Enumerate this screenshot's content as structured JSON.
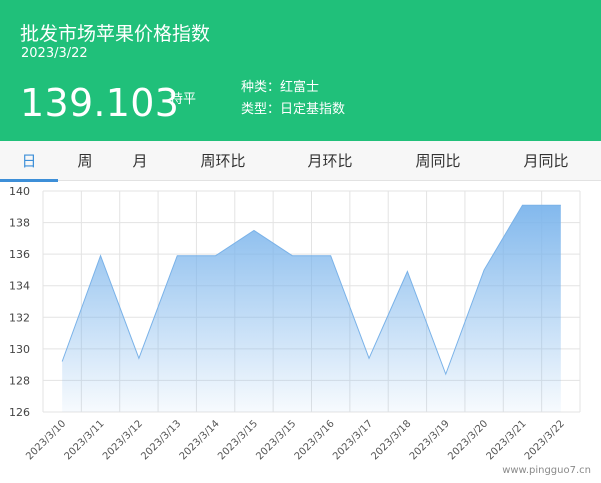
{
  "header": {
    "title": "批发市场苹果价格指数",
    "date": "2023/3/22",
    "price": "139.103",
    "trend": "持平",
    "variety": "种类：红富士",
    "index_type": "类型：日定基指数"
  },
  "tabs": [
    {
      "label": "日",
      "active": true
    },
    {
      "label": "周",
      "active": false
    },
    {
      "label": "月",
      "active": false
    },
    {
      "label": "周环比",
      "active": false
    },
    {
      "label": "月环比",
      "active": false
    },
    {
      "label": "周同比",
      "active": false
    },
    {
      "label": "月同比",
      "active": false
    }
  ],
  "colors": {
    "header_bg": "#20c07a",
    "accent": "#3d8fd8",
    "series_line": "#7ab2e8",
    "series_fill_top": "#7cb5ec"
  },
  "watermark": "www.pingguo7.cn",
  "chart_data": {
    "type": "area",
    "categories": [
      "2023/3/10",
      "2023/3/11",
      "2023/3/12",
      "2023/3/13",
      "2023/3/14",
      "2023/3/15",
      "2023/3/15",
      "2023/3/16",
      "2023/3/17",
      "2023/3/18",
      "2023/3/19",
      "2023/3/20",
      "2023/3/21",
      "2023/3/22"
    ],
    "values": [
      129.2,
      135.9,
      129.4,
      135.9,
      135.9,
      137.5,
      135.9,
      135.9,
      129.4,
      134.9,
      128.4,
      135.0,
      139.1,
      139.1
    ],
    "ylim": [
      126,
      140
    ],
    "yticks": [
      126,
      128,
      130,
      132,
      134,
      136,
      138,
      140
    ],
    "grid": true,
    "legend": "none"
  }
}
